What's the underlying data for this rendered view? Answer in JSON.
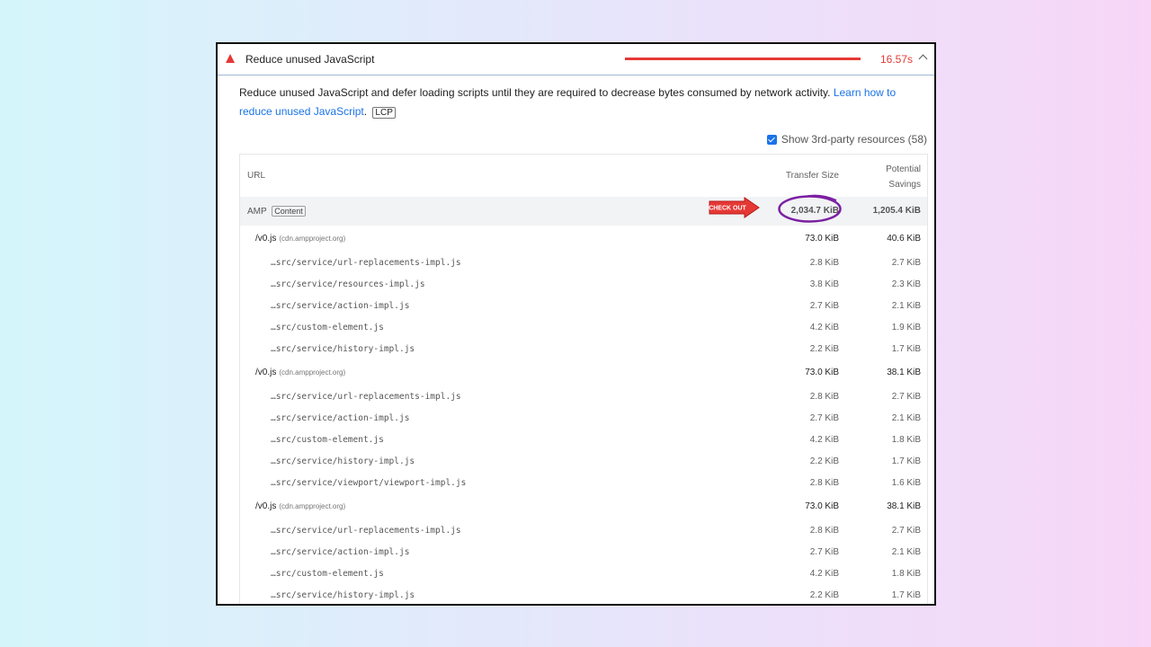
{
  "audit": {
    "title": "Reduce unused JavaScript",
    "timing": "16.57s",
    "description_text": "Reduce unused JavaScript and defer loading scripts until they are required to decrease bytes consumed by network activity.",
    "learn_more_link": "Learn how to reduce unused JavaScript",
    "badge": "LCP",
    "accent_color": "#e53935"
  },
  "checkbox": {
    "label": "Show 3rd-party resources (58)",
    "checked": true
  },
  "table": {
    "headers": {
      "url": "URL",
      "size": "Transfer Size",
      "savings_line1": "Potential",
      "savings_line2": "Savings"
    },
    "group": {
      "name": "AMP",
      "tag": "Content",
      "size": "2,034.7 KiB",
      "savings": "1,205.4 KiB"
    },
    "parents": [
      {
        "name": "/v0.js",
        "domain": "(cdn.ampproject.org)",
        "size": "73.0 KiB",
        "savings": "40.6 KiB",
        "children": [
          {
            "file": "…src/service/url-replacements-impl.js",
            "size": "2.8 KiB",
            "savings": "2.7 KiB"
          },
          {
            "file": "…src/service/resources-impl.js",
            "size": "3.8 KiB",
            "savings": "2.3 KiB"
          },
          {
            "file": "…src/service/action-impl.js",
            "size": "2.7 KiB",
            "savings": "2.1 KiB"
          },
          {
            "file": "…src/custom-element.js",
            "size": "4.2 KiB",
            "savings": "1.9 KiB"
          },
          {
            "file": "…src/service/history-impl.js",
            "size": "2.2 KiB",
            "savings": "1.7 KiB"
          }
        ]
      },
      {
        "name": "/v0.js",
        "domain": "(cdn.ampproject.org)",
        "size": "73.0 KiB",
        "savings": "38.1 KiB",
        "children": [
          {
            "file": "…src/service/url-replacements-impl.js",
            "size": "2.8 KiB",
            "savings": "2.7 KiB"
          },
          {
            "file": "…src/service/action-impl.js",
            "size": "2.7 KiB",
            "savings": "2.1 KiB"
          },
          {
            "file": "…src/custom-element.js",
            "size": "4.2 KiB",
            "savings": "1.8 KiB"
          },
          {
            "file": "…src/service/history-impl.js",
            "size": "2.2 KiB",
            "savings": "1.7 KiB"
          },
          {
            "file": "…src/service/viewport/viewport-impl.js",
            "size": "2.8 KiB",
            "savings": "1.6 KiB"
          }
        ]
      },
      {
        "name": "/v0.js",
        "domain": "(cdn.ampproject.org)",
        "size": "73.0 KiB",
        "savings": "38.1 KiB",
        "children": [
          {
            "file": "…src/service/url-replacements-impl.js",
            "size": "2.8 KiB",
            "savings": "2.7 KiB"
          },
          {
            "file": "…src/service/action-impl.js",
            "size": "2.7 KiB",
            "savings": "2.1 KiB"
          },
          {
            "file": "…src/custom-element.js",
            "size": "4.2 KiB",
            "savings": "1.8 KiB"
          },
          {
            "file": "…src/service/history-impl.js",
            "size": "2.2 KiB",
            "savings": "1.7 KiB"
          }
        ]
      }
    ]
  },
  "annotation": {
    "arrow_text": "CHECK OUT",
    "arrow_color": "#e53935",
    "circle_color": "#7b1fa2"
  }
}
